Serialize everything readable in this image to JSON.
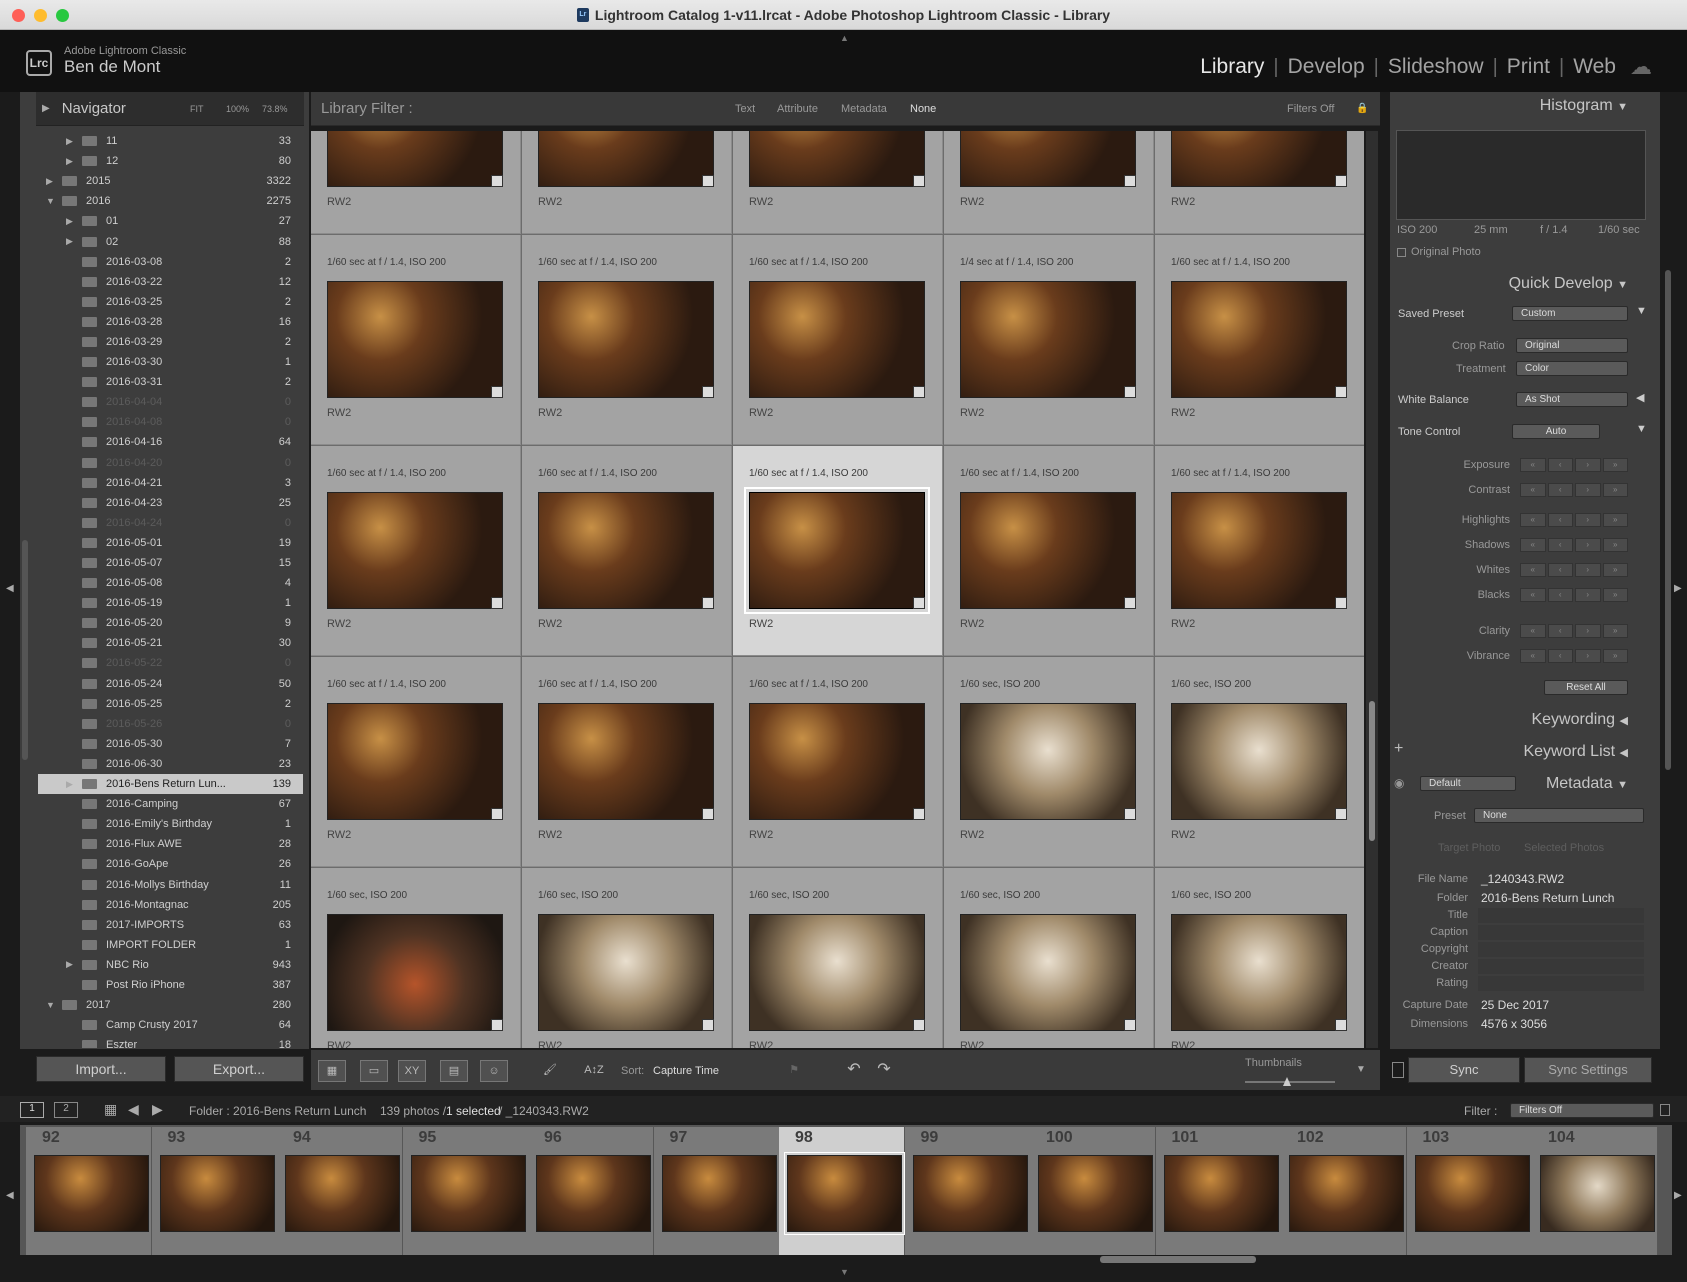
{
  "window": {
    "title": "Lightroom Catalog 1-v11.lrcat - Adobe Photoshop Lightroom Classic - Library"
  },
  "identity": {
    "subtitle": "Adobe Lightroom Classic",
    "user": "Ben de Mont",
    "logo": "Lrc"
  },
  "modules": [
    "Library",
    "Develop",
    "Slideshow",
    "Print",
    "Web"
  ],
  "navigator": {
    "title": "Navigator",
    "zoom": [
      "FIT",
      "100%",
      "73.8%"
    ]
  },
  "folders": [
    {
      "name": "11",
      "count": "33",
      "level": 2,
      "tri": "▶"
    },
    {
      "name": "12",
      "count": "80",
      "level": 2,
      "tri": "▶"
    },
    {
      "name": "2015",
      "count": "3322",
      "level": 1,
      "tri": "▶"
    },
    {
      "name": "2016",
      "count": "2275",
      "level": 1,
      "tri": "▼"
    },
    {
      "name": "01",
      "count": "27",
      "level": 2,
      "tri": "▶"
    },
    {
      "name": "02",
      "count": "88",
      "level": 2,
      "tri": "▶"
    },
    {
      "name": "2016-03-08",
      "count": "2",
      "level": 2
    },
    {
      "name": "2016-03-22",
      "count": "12",
      "level": 2
    },
    {
      "name": "2016-03-25",
      "count": "2",
      "level": 2
    },
    {
      "name": "2016-03-28",
      "count": "16",
      "level": 2
    },
    {
      "name": "2016-03-29",
      "count": "2",
      "level": 2
    },
    {
      "name": "2016-03-30",
      "count": "1",
      "level": 2
    },
    {
      "name": "2016-03-31",
      "count": "2",
      "level": 2
    },
    {
      "name": "2016-04-04",
      "count": "0",
      "level": 2,
      "dim": true
    },
    {
      "name": "2016-04-08",
      "count": "0",
      "level": 2,
      "dim": true
    },
    {
      "name": "2016-04-16",
      "count": "64",
      "level": 2
    },
    {
      "name": "2016-04-20",
      "count": "0",
      "level": 2,
      "dim": true
    },
    {
      "name": "2016-04-21",
      "count": "3",
      "level": 2
    },
    {
      "name": "2016-04-23",
      "count": "25",
      "level": 2
    },
    {
      "name": "2016-04-24",
      "count": "0",
      "level": 2,
      "dim": true
    },
    {
      "name": "2016-05-01",
      "count": "19",
      "level": 2
    },
    {
      "name": "2016-05-07",
      "count": "15",
      "level": 2
    },
    {
      "name": "2016-05-08",
      "count": "4",
      "level": 2
    },
    {
      "name": "2016-05-19",
      "count": "1",
      "level": 2
    },
    {
      "name": "2016-05-20",
      "count": "9",
      "level": 2
    },
    {
      "name": "2016-05-21",
      "count": "30",
      "level": 2
    },
    {
      "name": "2016-05-22",
      "count": "0",
      "level": 2,
      "dim": true
    },
    {
      "name": "2016-05-24",
      "count": "50",
      "level": 2
    },
    {
      "name": "2016-05-25",
      "count": "2",
      "level": 2
    },
    {
      "name": "2016-05-26",
      "count": "0",
      "level": 2,
      "dim": true
    },
    {
      "name": "2016-05-30",
      "count": "7",
      "level": 2
    },
    {
      "name": "2016-06-30",
      "count": "23",
      "level": 2
    },
    {
      "name": "2016-Bens Return Lun...",
      "count": "139",
      "level": 2,
      "tri": "▶",
      "selected": true
    },
    {
      "name": "2016-Camping",
      "count": "67",
      "level": 2
    },
    {
      "name": "2016-Emily's Birthday",
      "count": "1",
      "level": 2
    },
    {
      "name": "2016-Flux AWE",
      "count": "28",
      "level": 2
    },
    {
      "name": "2016-GoApe",
      "count": "26",
      "level": 2
    },
    {
      "name": "2016-Mollys Birthday",
      "count": "11",
      "level": 2
    },
    {
      "name": "2016-Montagnac",
      "count": "205",
      "level": 2
    },
    {
      "name": "2017-IMPORTS",
      "count": "63",
      "level": 2
    },
    {
      "name": "IMPORT FOLDER",
      "count": "1",
      "level": 2
    },
    {
      "name": "NBC Rio",
      "count": "943",
      "level": 2,
      "tri": "▶"
    },
    {
      "name": "Post Rio iPhone",
      "count": "387",
      "level": 2
    },
    {
      "name": "2017",
      "count": "280",
      "level": 1,
      "tri": "▼"
    },
    {
      "name": "Camp Crusty 2017",
      "count": "64",
      "level": 2
    },
    {
      "name": "Eszter",
      "count": "18",
      "level": 2
    }
  ],
  "left_buttons": {
    "import": "Import...",
    "export": "Export..."
  },
  "filter_bar": {
    "label": "Library Filter :",
    "options": [
      "Text",
      "Attribute",
      "Metadata",
      "None"
    ],
    "active": "None",
    "status": "Filters Off"
  },
  "grid": [
    [
      "",
      "",
      "",
      "",
      ""
    ],
    [
      "1/60 sec at f / 1.4, ISO 200",
      "1/60 sec at f / 1.4, ISO 200",
      "1/60 sec at f / 1.4, ISO 200",
      "1/4 sec at f / 1.4, ISO 200",
      "1/60 sec at f / 1.4, ISO 200"
    ],
    [
      "1/60 sec at f / 1.4, ISO 200",
      "1/60 sec at f / 1.4, ISO 200",
      "1/60 sec at f / 1.4, ISO 200",
      "1/60 sec at f / 1.4, ISO 200",
      "1/60 sec at f / 1.4, ISO 200"
    ],
    [
      "1/60 sec at f / 1.4, ISO 200",
      "1/60 sec at f / 1.4, ISO 200",
      "1/60 sec at f / 1.4, ISO 200",
      "1/60 sec, ISO 200",
      "1/60 sec, ISO 200"
    ],
    [
      "1/60 sec, ISO 200",
      "1/60 sec, ISO 200",
      "1/60 sec, ISO 200",
      "1/60 sec, ISO 200",
      "1/60 sec, ISO 200"
    ]
  ],
  "grid_ext": "RW2",
  "toolbar": {
    "sort_label": "Sort:",
    "sort_value": "Capture Time",
    "thumbnails": "Thumbnails"
  },
  "histogram": {
    "title": "Histogram",
    "iso": "ISO 200",
    "focal": "25 mm",
    "aperture": "f / 1.4",
    "shutter": "1/60 sec",
    "original": "Original Photo"
  },
  "quick_develop": {
    "title": "Quick Develop",
    "saved_preset": {
      "label": "Saved Preset",
      "value": "Custom"
    },
    "crop_ratio": {
      "label": "Crop Ratio",
      "value": "Original"
    },
    "treatment": {
      "label": "Treatment",
      "value": "Color"
    },
    "white_balance": {
      "label": "White Balance",
      "value": "As Shot"
    },
    "tone": {
      "label": "Tone Control",
      "value": "Auto"
    },
    "controls": [
      "Exposure",
      "Contrast",
      "Highlights",
      "Shadows",
      "Whites",
      "Blacks",
      "Clarity",
      "Vibrance"
    ],
    "reset": "Reset All"
  },
  "keywording": "Keywording",
  "keyword_list": "Keyword List",
  "metadata": {
    "title": "Metadata",
    "view": "Default",
    "preset_label": "Preset",
    "preset_value": "None",
    "target": "Target Photo",
    "selected": "Selected Photos",
    "fields": [
      {
        "label": "File Name",
        "value": "_1240343.RW2"
      },
      {
        "label": "Folder",
        "value": "2016-Bens Return Lunch"
      },
      {
        "label": "Title",
        "value": ""
      },
      {
        "label": "Caption",
        "value": ""
      },
      {
        "label": "Copyright",
        "value": ""
      },
      {
        "label": "Creator",
        "value": ""
      },
      {
        "label": "Rating",
        "value": ""
      },
      {
        "label": "Capture Date",
        "value": "25 Dec 2017"
      },
      {
        "label": "Dimensions",
        "value": "4576 x 3056"
      }
    ]
  },
  "sync": {
    "sync": "Sync",
    "settings": "Sync Settings"
  },
  "filmstrip_bar": {
    "screens": [
      "1",
      "2"
    ],
    "folder": "Folder : 2016-Bens Return Lunch",
    "count": "139 photos /",
    "selected": "1 selected",
    "file": "/ _1240343.RW2",
    "filter_label": "Filter :",
    "filter_value": "Filters Off"
  },
  "filmstrip": [
    "92",
    "93",
    "94",
    "95",
    "96",
    "97",
    "98",
    "99",
    "100",
    "101",
    "102",
    "103",
    "104"
  ],
  "filmstrip_selected": "98",
  "colors": {
    "accent": "#c9c9c9",
    "panel": "#3d3d3d",
    "bg": "#1b1b1b"
  }
}
